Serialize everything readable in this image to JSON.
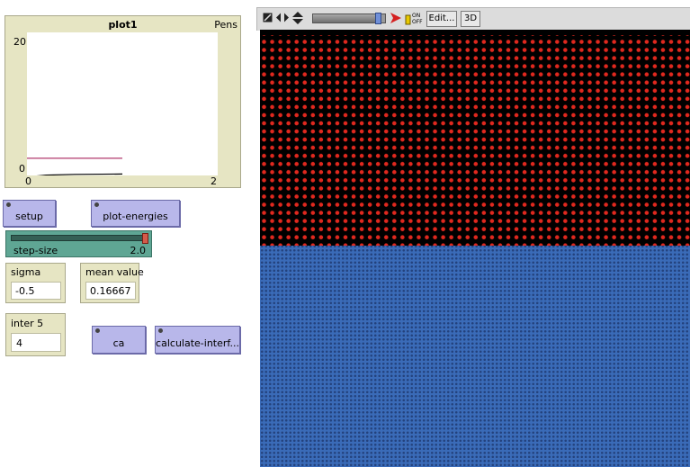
{
  "plot": {
    "title": "plot1",
    "pens_label": "Pens",
    "y_max": "20",
    "y_min": "0",
    "x_min": "0",
    "x_max": "2"
  },
  "chart_data": {
    "type": "line",
    "title": "plot1",
    "xlim": [
      0,
      2
    ],
    "ylim": [
      0,
      20
    ],
    "series": [
      {
        "color": "#b23a6d",
        "x": [
          0,
          1
        ],
        "y": [
          2.4,
          2.4
        ]
      },
      {
        "color": "#000000",
        "x": [
          0,
          0.2,
          0.5,
          1
        ],
        "y": [
          -0.2,
          0.05,
          0.15,
          0.2
        ]
      }
    ]
  },
  "buttons": {
    "setup": "setup",
    "plot_energies": "plot-energies",
    "ca": "ca",
    "calculate_interf": "calculate-interf..."
  },
  "slider": {
    "label": "step-size",
    "value": "2.0",
    "fraction": 1.0
  },
  "monitors": {
    "sigma": {
      "label": "sigma",
      "value": "-0.5"
    },
    "mean_value": {
      "label": "mean value",
      "value": "0.16667"
    },
    "inter5": {
      "label": "inter 5",
      "value": "4"
    }
  },
  "toolbar": {
    "edit": "Edit...",
    "three_d": "3D",
    "speed_fraction": 0.95,
    "icons": [
      "resize-icon",
      "horizontal-arrows-icon",
      "vertical-arrows-icon",
      "red-arrow-icon",
      "on-off-switch-icon"
    ]
  },
  "world": {
    "top_color": "#000000",
    "dot_color": "#e0281e",
    "bottom_color": "#3a6bb8",
    "bottom_dot_color": "#243f78"
  }
}
